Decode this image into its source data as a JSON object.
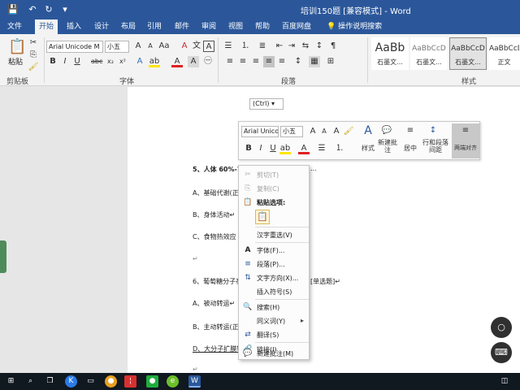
{
  "window": {
    "title": "培训150题 [兼容模式] - Word",
    "quick_access": {
      "save": "💾",
      "undo": "↶",
      "redo": "↻",
      "more": "▾"
    }
  },
  "tabs": [
    "文件",
    "开始",
    "插入",
    "设计",
    "布局",
    "引用",
    "邮件",
    "审阅",
    "视图",
    "帮助",
    "百度网盘"
  ],
  "tell_me": "操作说明搜索",
  "ribbon": {
    "groups": {
      "clipboard": "剪贴板",
      "font": "字体",
      "paragraph": "段落",
      "styles": "样式"
    },
    "paste_label": "粘贴",
    "font_name": "Arial Unicode M",
    "font_size": "小五",
    "styles": [
      {
        "sample": "AaBb",
        "name": "石墨文..."
      },
      {
        "sample": "AaBbCcD",
        "name": "石墨文..."
      },
      {
        "sample": "AaBbCcD",
        "name": "石墨文..."
      },
      {
        "sample": "AaBbCcD",
        "name": "正文"
      }
    ]
  },
  "document": {
    "lines": [
      {
        "id": "q5",
        "text": "5、人体 60%-70%"
      },
      {
        "id": "q5a",
        "text": "A、基础代谢(正"
      },
      {
        "id": "q5b",
        "text": "B、身体活动↵"
      },
      {
        "id": "q5c",
        "text": "C、食物热效应 D"
      },
      {
        "id": "q6",
        "text": "6、葡萄糖分子在"
      },
      {
        "id": "q6a",
        "text": "A、被动转运↵"
      },
      {
        "id": "q6b",
        "text": "B、主动转运(正"
      },
      {
        "id": "q6d",
        "text": "D、大分子扩膜转"
      }
    ],
    "q5_tail": "…",
    "q6_tail": "[单选题]↵"
  },
  "paste_ctrl": "(Ctrl) ▾",
  "mini_toolbar": {
    "font_name": "Arial Unico",
    "font_size": "小五",
    "labels": {
      "styles": "样式",
      "new_comment": "新建批注",
      "center": "居中",
      "line_para_spacing": "行和段落间距",
      "justify": "两端对齐"
    }
  },
  "context_menu": [
    {
      "key": "cut",
      "label": "剪切(T)",
      "icon": "✂",
      "disabled": true
    },
    {
      "key": "copy",
      "label": "复制(C)",
      "icon": "⎘",
      "disabled": true
    },
    {
      "key": "paste_options",
      "label": "粘贴选项:",
      "icon": "📋",
      "disabled": false
    },
    {
      "key": "reconvert",
      "label": "汉字重选(V)",
      "icon": "",
      "disabled": false
    },
    {
      "key": "font",
      "label": "字体(F)...",
      "icon": "A",
      "disabled": false
    },
    {
      "key": "paragraph",
      "label": "段落(P)...",
      "icon": "≡",
      "disabled": false
    },
    {
      "key": "text_direction",
      "label": "文字方向(X)...",
      "icon": "⇅",
      "disabled": false
    },
    {
      "key": "insert_symbol",
      "label": "插入符号(S)",
      "icon": "",
      "disabled": false
    },
    {
      "key": "search",
      "label": "搜索(H)",
      "icon": "🔍",
      "disabled": false
    },
    {
      "key": "synonyms",
      "label": "同义词(Y)",
      "icon": "",
      "disabled": false,
      "submenu": "▸"
    },
    {
      "key": "translate",
      "label": "翻译(S)",
      "icon": "⇄",
      "disabled": false
    },
    {
      "key": "link",
      "label": "链接(I)",
      "icon": "🔗",
      "disabled": false
    },
    {
      "key": "new_comment",
      "label": "新建批注(M)",
      "icon": "💬",
      "disabled": false
    }
  ],
  "colors": {
    "title_bg": "#2b579a",
    "ribbon_bg": "#f3f3f3",
    "taskbar_bg": "#101820",
    "font_color_red": "#e02020",
    "highlight_yellow": "#ffe600"
  }
}
